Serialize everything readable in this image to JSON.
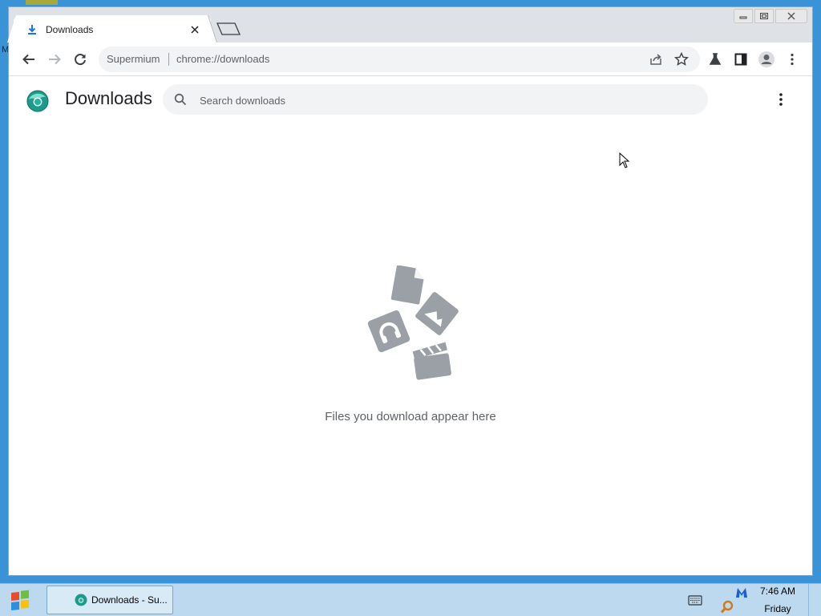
{
  "desktop": {
    "edge_letter": "M"
  },
  "browser": {
    "tab": {
      "title": "Downloads"
    },
    "omnibox": {
      "site_name": "Supermium",
      "url": "chrome://downloads"
    }
  },
  "downloads_page": {
    "title": "Downloads",
    "search_placeholder": "Search downloads",
    "empty_message": "Files you download appear here"
  },
  "taskbar": {
    "items": [
      {
        "label": "Downloads - Su..."
      }
    ],
    "clock": {
      "time": "7:46 AM",
      "day": "Friday"
    }
  },
  "colors": {
    "accent": "#1a73e8",
    "illustration": "#9aa0a6",
    "taskbar": "#bcd9ef"
  }
}
